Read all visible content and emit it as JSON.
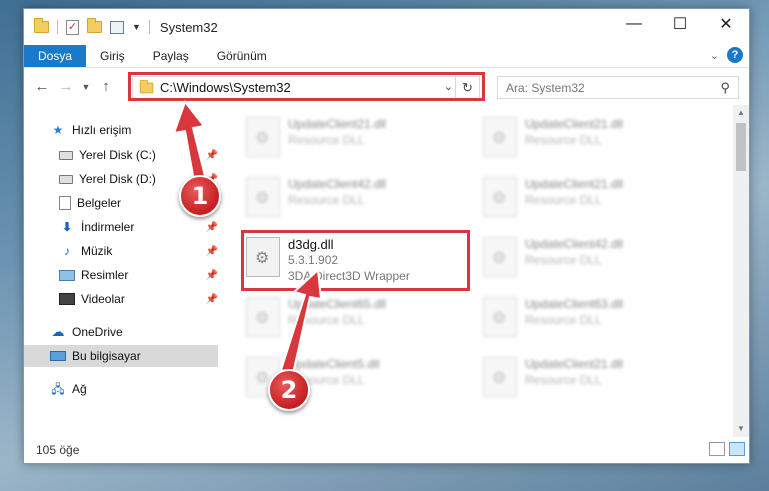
{
  "window": {
    "title": "System32",
    "controls": {
      "minimize": "—",
      "maximize": "☐",
      "close": "✕"
    }
  },
  "ribbon": {
    "tabs": [
      {
        "label": "Dosya",
        "active": true
      },
      {
        "label": "Giriş"
      },
      {
        "label": "Paylaş"
      },
      {
        "label": "Görünüm"
      }
    ],
    "help": "?"
  },
  "nav": {
    "address": "C:\\Windows\\System32",
    "search_placeholder": "Ara: System32"
  },
  "sidebar": {
    "items": [
      {
        "label": "Hızlı erişim",
        "icon": "star-icon"
      },
      {
        "label": "Yerel Disk (C:)",
        "icon": "drive-icon",
        "pinned": true
      },
      {
        "label": "Yerel Disk (D:)",
        "icon": "drive-icon",
        "pinned": true
      },
      {
        "label": "Belgeler",
        "icon": "documents-icon",
        "pinned": true
      },
      {
        "label": "İndirmeler",
        "icon": "downloads-icon",
        "pinned": true
      },
      {
        "label": "Müzik",
        "icon": "music-icon",
        "pinned": true
      },
      {
        "label": "Resimler",
        "icon": "pictures-icon",
        "pinned": true
      },
      {
        "label": "Videolar",
        "icon": "videos-icon",
        "pinned": true
      },
      {
        "label": "OneDrive",
        "icon": "cloud-icon"
      },
      {
        "label": "Bu bilgisayar",
        "icon": "computer-icon",
        "selected": true
      },
      {
        "label": "Ağ",
        "icon": "network-icon"
      }
    ]
  },
  "files": [
    {
      "name": "UpdateClient21.dll",
      "sub": "Resource DLL",
      "blurred": true
    },
    {
      "name": "UpdateClient21.dll",
      "sub": "Resource DLL",
      "blurred": true
    },
    {
      "name": "UpdateClient42.dll",
      "sub": "Resource DLL",
      "blurred": true
    },
    {
      "name": "UpdateClient21.dll",
      "sub": "Resource DLL",
      "blurred": true
    },
    {
      "name": "d3dg.dll",
      "version": "5.3.1.902",
      "sub": "3DA Direct3D Wrapper",
      "blurred": false
    },
    {
      "name": "UpdateClient42.dll",
      "sub": "Resource DLL",
      "blurred": true
    },
    {
      "name": "UpdateClient65.dll",
      "sub": "Resource DLL",
      "blurred": true
    },
    {
      "name": "UpdateClient63.dll",
      "sub": "Resource DLL",
      "blurred": true
    },
    {
      "name": "UpdateClient5.dll",
      "sub": "Resource DLL",
      "blurred": true
    },
    {
      "name": "UpdateClient21.dll",
      "sub": "Resource DLL",
      "blurred": true
    }
  ],
  "status": {
    "count": "105 öğe"
  },
  "annotations": {
    "badge1": "1",
    "badge2": "2",
    "color": "#d9363e"
  }
}
